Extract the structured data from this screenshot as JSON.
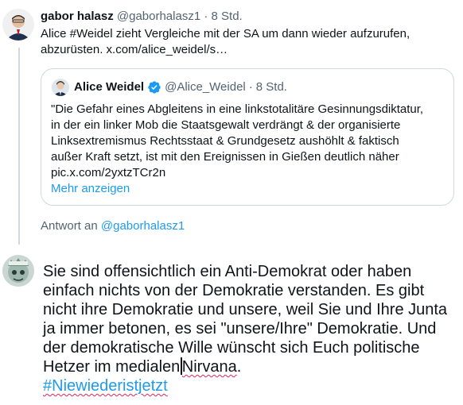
{
  "parent_tweet": {
    "author_name": "gabor halasz",
    "author_handle": "@gaborhalasz1",
    "separator": "·",
    "time": "8 Std.",
    "text": "Alice #Weidel zieht Vergleiche mit der SA um dann wieder aufzurufen, abzurüsten. x.com/alice_weidel/s…"
  },
  "quoted_tweet": {
    "author_name": "Alice Weidel",
    "author_handle": "@Alice_Weidel",
    "separator": "·",
    "time": "8 Std.",
    "verified_icon": "verified-badge-icon",
    "text_lines": [
      "\"Die Gefahr eines Abgleitens in eine linkstotalitäre Gesinnungsdiktatur,",
      "in der ein linker Mob die Staatsgewalt verdrängt & der organisierte",
      "Linksextremismus Rechtsstaat & Grundgesetz aushöhlt & faktisch",
      "außer Kraft setzt, ist mit den Ereignissen in Gießen deutlich näher",
      "pic.x.com/2yxtzTCr2n"
    ],
    "show_more_label": "Mehr anzeigen"
  },
  "reply_context": {
    "prefix": "Antwort an",
    "handle": "@gaborhalasz1"
  },
  "composer": {
    "text_before_caret": "Sie sind offensichtlich ein Anti-Demokrat oder haben einfach nichts von der Demokratie verstanden. Es gibt nicht ihre Demokratie und unsere, weil Sie und Ihre Junta ja immer betonen, es sei \"unsere/Ihre\" Demokratie. Und der demokratische Wille wünscht sich Euch politische Hetzer im medialen",
    "misspelled_word": "Nirvana",
    "text_after_word": ".",
    "hashtag": "#Niewiederistjetzt"
  },
  "colors": {
    "accent": "#1d9bf0",
    "text_primary": "#0f1419",
    "text_secondary": "#536471",
    "border": "#cfd9de",
    "spellcheck": "#e0245e"
  }
}
